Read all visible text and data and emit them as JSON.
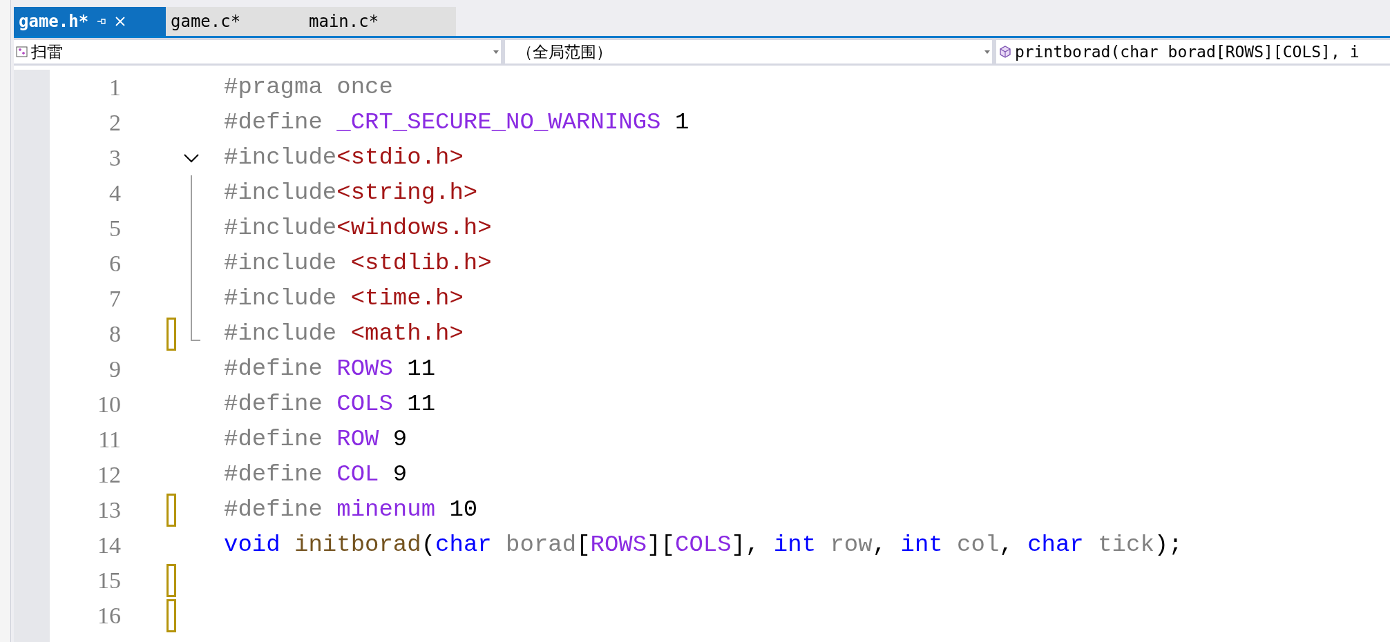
{
  "tabs": [
    {
      "label": "game.h*",
      "selected": true
    },
    {
      "label": "game.c*",
      "selected": false
    },
    {
      "label": "main.c*",
      "selected": false
    }
  ],
  "navigation": [
    {
      "kind": "project",
      "value": "扫雷"
    },
    {
      "kind": "scope",
      "value": "（全局范围）"
    },
    {
      "kind": "member",
      "value": "printborad(char borad[ROWS][COLS], i"
    }
  ],
  "lines": [
    {
      "number": "1",
      "changed": false,
      "tokens": [
        {
          "kind": "pre",
          "text": "#pragma once"
        }
      ]
    },
    {
      "number": "2",
      "changed": false,
      "tokens": [
        {
          "kind": "pre",
          "text": "#define "
        },
        {
          "kind": "macro",
          "text": "_CRT_SECURE_NO_WARNINGS"
        },
        {
          "kind": "plain",
          "text": " 1"
        }
      ]
    },
    {
      "number": "3",
      "changed": false,
      "expanded": true,
      "tokens": [
        {
          "kind": "pre",
          "text": "#include"
        },
        {
          "kind": "string",
          "text": "<stdio.h>"
        }
      ]
    },
    {
      "number": "4",
      "changed": false,
      "in_fold": true,
      "tokens": [
        {
          "kind": "pre",
          "text": "#include"
        },
        {
          "kind": "string",
          "text": "<string.h>"
        }
      ]
    },
    {
      "number": "5",
      "changed": false,
      "in_fold": true,
      "tokens": [
        {
          "kind": "pre",
          "text": "#include"
        },
        {
          "kind": "string",
          "text": "<windows.h>"
        }
      ]
    },
    {
      "number": "6",
      "changed": false,
      "in_fold": true,
      "tokens": [
        {
          "kind": "pre",
          "text": "#include "
        },
        {
          "kind": "string",
          "text": "<stdlib.h>"
        }
      ]
    },
    {
      "number": "7",
      "changed": false,
      "in_fold": true,
      "tokens": [
        {
          "kind": "pre",
          "text": "#include "
        },
        {
          "kind": "string",
          "text": "<time.h>"
        }
      ]
    },
    {
      "number": "8",
      "changed": true,
      "in_fold": true,
      "tokens": [
        {
          "kind": "pre",
          "text": "#include "
        },
        {
          "kind": "string",
          "text": "<math.h>"
        }
      ]
    },
    {
      "number": "9",
      "changed": false,
      "tokens": [
        {
          "kind": "pre",
          "text": "#define "
        },
        {
          "kind": "macro",
          "text": "ROWS"
        },
        {
          "kind": "plain",
          "text": " 11"
        }
      ]
    },
    {
      "number": "10",
      "changed": false,
      "tokens": [
        {
          "kind": "pre",
          "text": "#define "
        },
        {
          "kind": "macro",
          "text": "COLS"
        },
        {
          "kind": "plain",
          "text": " 11"
        }
      ]
    },
    {
      "number": "11",
      "changed": false,
      "tokens": [
        {
          "kind": "pre",
          "text": "#define "
        },
        {
          "kind": "macro",
          "text": "ROW"
        },
        {
          "kind": "plain",
          "text": " 9"
        }
      ]
    },
    {
      "number": "12",
      "changed": false,
      "tokens": [
        {
          "kind": "pre",
          "text": "#define "
        },
        {
          "kind": "macro",
          "text": "COL"
        },
        {
          "kind": "plain",
          "text": " 9"
        }
      ]
    },
    {
      "number": "13",
      "changed": true,
      "tokens": [
        {
          "kind": "pre",
          "text": "#define "
        },
        {
          "kind": "macro",
          "text": "minenum"
        },
        {
          "kind": "plain",
          "text": " 10"
        }
      ]
    },
    {
      "number": "14",
      "changed": false,
      "tokens": [
        {
          "kind": "keyword",
          "text": "void "
        },
        {
          "kind": "function",
          "text": "initborad"
        },
        {
          "kind": "plain",
          "text": "("
        },
        {
          "kind": "keyword",
          "text": "char "
        },
        {
          "kind": "param",
          "text": "borad"
        },
        {
          "kind": "plain",
          "text": "["
        },
        {
          "kind": "macro",
          "text": "ROWS"
        },
        {
          "kind": "plain",
          "text": "]["
        },
        {
          "kind": "macro",
          "text": "COLS"
        },
        {
          "kind": "plain",
          "text": "], "
        },
        {
          "kind": "keyword",
          "text": "int "
        },
        {
          "kind": "param",
          "text": "row"
        },
        {
          "kind": "plain",
          "text": ", "
        },
        {
          "kind": "keyword",
          "text": "int "
        },
        {
          "kind": "param",
          "text": "col"
        },
        {
          "kind": "plain",
          "text": ", "
        },
        {
          "kind": "keyword",
          "text": "char "
        },
        {
          "kind": "param",
          "text": "tick"
        },
        {
          "kind": "plain",
          "text": ");"
        }
      ]
    },
    {
      "number": "15",
      "changed": true
    },
    {
      "number": "16",
      "changed": true
    }
  ]
}
